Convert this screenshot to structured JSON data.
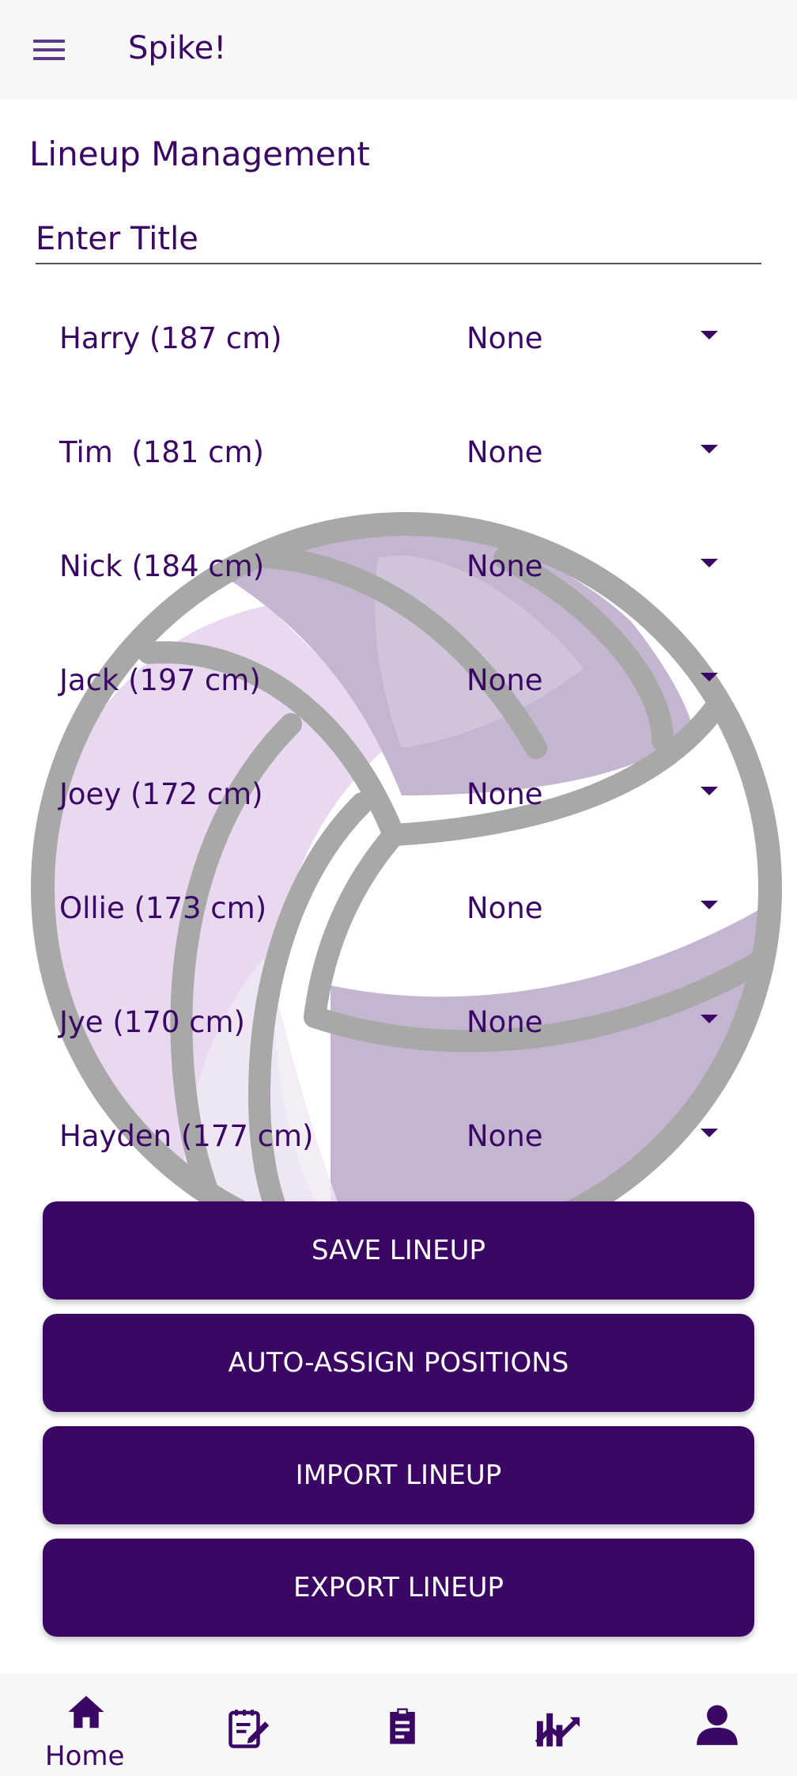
{
  "app_bar": {
    "title": "Spike!",
    "menu_icon": "hamburger-menu-icon"
  },
  "page": {
    "heading": "Lineup Management",
    "title_input": {
      "placeholder": "Enter Title",
      "value": ""
    }
  },
  "players": [
    {
      "name": "Harry (187 cm)",
      "position": "None"
    },
    {
      "name": "Tim  (181 cm)",
      "position": "None"
    },
    {
      "name": "Nick (184 cm)",
      "position": "None"
    },
    {
      "name": "Jack (197 cm)",
      "position": "None"
    },
    {
      "name": "Joey (172 cm)",
      "position": "None"
    },
    {
      "name": "Ollie (173 cm)",
      "position": "None"
    },
    {
      "name": "Jye (170 cm)",
      "position": "None"
    },
    {
      "name": "Hayden (177 cm)",
      "position": "None"
    }
  ],
  "buttons": {
    "save": "SAVE LINEUP",
    "auto_assign": "AUTO-ASSIGN POSITIONS",
    "import": "IMPORT LINEUP",
    "export": "EXPORT LINEUP"
  },
  "bottom_nav": [
    {
      "id": "home",
      "label": "Home",
      "icon": "home-icon",
      "active": true
    },
    {
      "id": "notes",
      "label": "",
      "icon": "notebook-edit-icon"
    },
    {
      "id": "clipboard",
      "label": "",
      "icon": "clipboard-icon"
    },
    {
      "id": "stats",
      "label": "",
      "icon": "chart-icon"
    },
    {
      "id": "profile",
      "label": "",
      "icon": "person-icon"
    }
  ],
  "colors": {
    "primary": "#3b0764",
    "app_bar_bg": "#f8f7f8",
    "ball_outline": "#a8a8a8",
    "ball_panel_dark": "#c4b5d0",
    "ball_panel_light": "#e8d8f0"
  }
}
